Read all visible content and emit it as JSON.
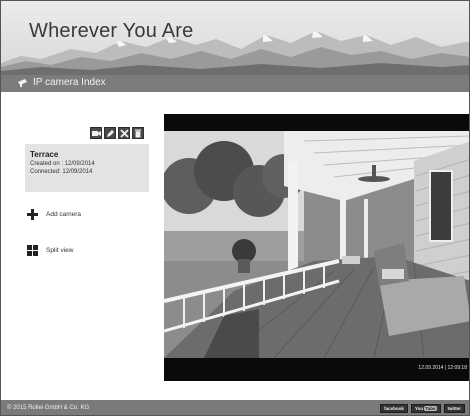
{
  "header": {
    "title": "Wherever You Are"
  },
  "nav": {
    "item_label": "IP camera Index",
    "item_icon": "camera-icon"
  },
  "camera_tools": [
    {
      "name": "view-icon"
    },
    {
      "name": "edit-icon"
    },
    {
      "name": "settings-icon"
    },
    {
      "name": "delete-icon"
    }
  ],
  "camera": {
    "name": "Terrace",
    "created": "Created on : 12/09/2014",
    "connected": "Connected: 12/09/2014"
  },
  "sidebar": {
    "add_camera": "Add camera",
    "split_view": "Split view"
  },
  "viewer": {
    "timestamp": "12.09.2014 | 12:09:18"
  },
  "footer": {
    "copyright": "© 2015 Rollei GmbH & Co. KG",
    "social": {
      "facebook": "facebook",
      "youtube_you": "You",
      "youtube_tube": "Tube",
      "twitter": "twitter"
    }
  },
  "colors": {
    "navbar": "#7c7c7c",
    "footer": "#7a7a7a",
    "card": "#e3e3e3"
  }
}
